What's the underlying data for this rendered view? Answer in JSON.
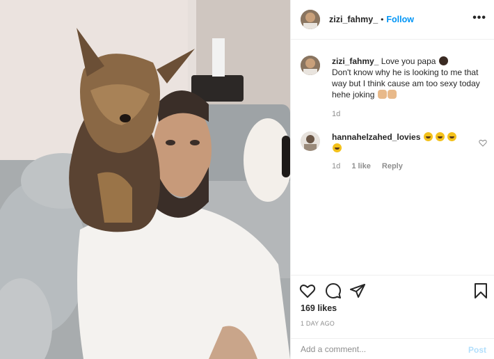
{
  "post": {
    "author": "zizi_fahmy_",
    "separator": "•",
    "follow_label": "Follow",
    "more_label": "•••"
  },
  "caption": {
    "username": "zizi_fahmy_",
    "text": "Love you papa",
    "text_line2": "Don't know why he is looking to me that way but I think cause am too sexy today hehe joking",
    "time": "1d"
  },
  "comments": [
    {
      "username": "hannahelzahed_lovies",
      "time": "1d",
      "likes": "1 like",
      "reply_label": "Reply"
    }
  ],
  "actions": {
    "likes_count": "169 likes",
    "date": "1 DAY AGO"
  },
  "composer": {
    "placeholder": "Add a comment...",
    "post_label": "Post"
  },
  "icons": {
    "like": "heart-icon",
    "comment": "comment-bubble-icon",
    "share": "paper-plane-icon",
    "save": "bookmark-icon"
  },
  "colors": {
    "accent": "#0095f6",
    "muted": "#8e8e8e",
    "post_disabled": "#b2dffc"
  }
}
